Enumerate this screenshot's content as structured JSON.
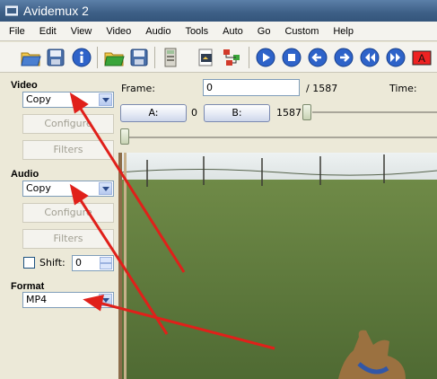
{
  "window": {
    "title": "Avidemux 2"
  },
  "menu": [
    "File",
    "Edit",
    "View",
    "Video",
    "Audio",
    "Tools",
    "Auto",
    "Go",
    "Custom",
    "Help"
  ],
  "left_panel": {
    "video": {
      "title": "Video",
      "codec": "Copy",
      "configure_label": "Configure",
      "filters_label": "Filters"
    },
    "audio": {
      "title": "Audio",
      "codec": "Copy",
      "configure_label": "Configure",
      "filters_label": "Filters"
    },
    "shift": {
      "label": "Shift:",
      "value": "0",
      "checked": false
    },
    "format": {
      "title": "Format",
      "value": "MP4"
    }
  },
  "navigation": {
    "frame_label": "Frame:",
    "frame_value": "0",
    "total_frames": "/ 1587",
    "time_label": "Time:",
    "marker_a_label": "A:",
    "marker_a_value": "0",
    "marker_b_label": "B:",
    "marker_b_value": "1587"
  },
  "annotation": {
    "arrow_color": "#e0201a"
  },
  "icons": [
    "open-folder-icon",
    "save-icon",
    "info-icon",
    "open-video-icon",
    "save-video-icon",
    "calculator-icon",
    "preview-output-icon",
    "filter-chain-icon",
    "play-icon",
    "stop-icon",
    "previous-frame-icon",
    "next-frame-icon",
    "previous-keyframe-icon",
    "next-keyframe-icon",
    "set-marker-a-icon"
  ]
}
